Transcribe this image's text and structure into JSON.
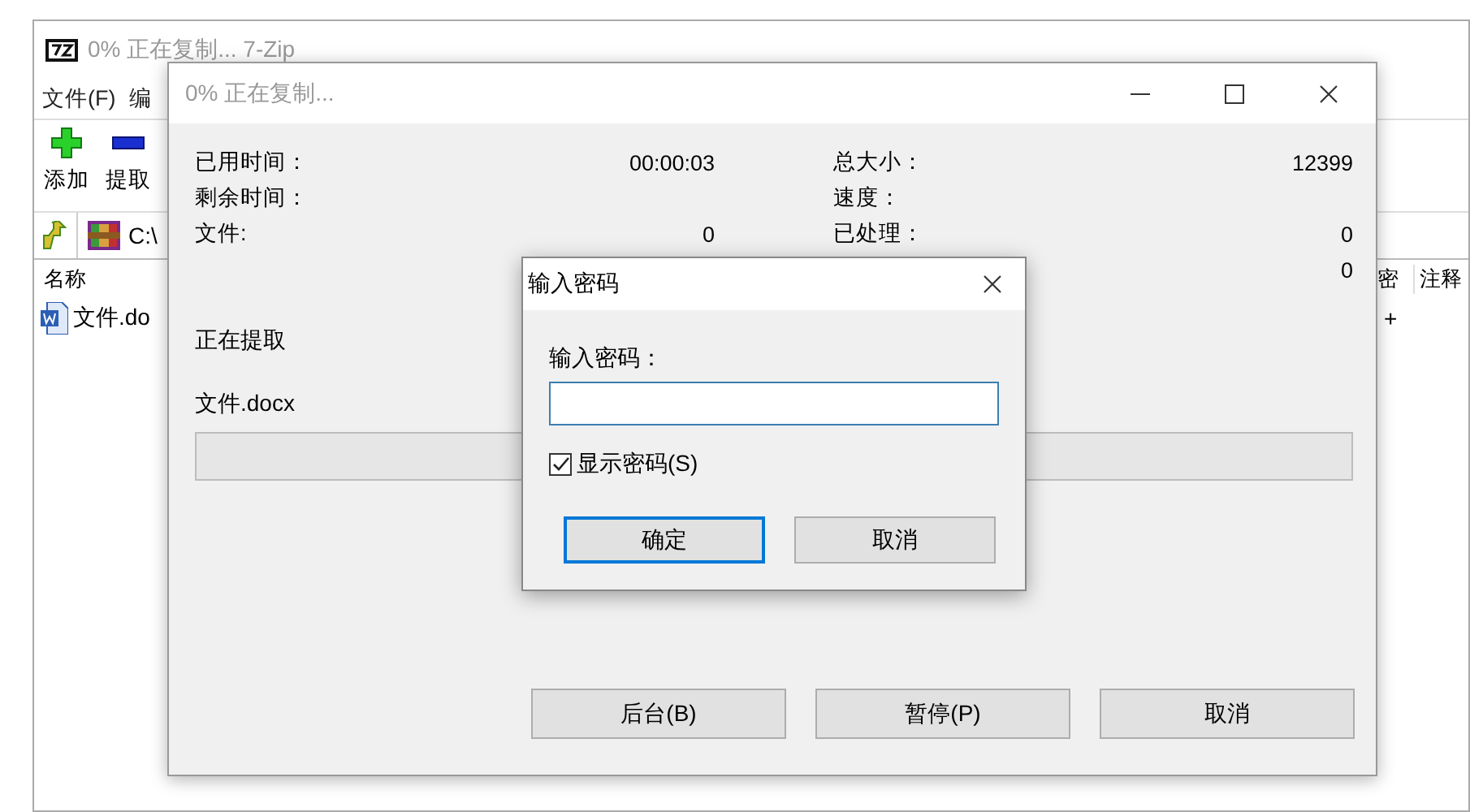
{
  "main_window": {
    "title": "0% 正在复制... 7-Zip",
    "active": false,
    "menu": [
      "文件(F)",
      "编"
    ],
    "toolbar": [
      {
        "kind": "add",
        "label": "添加"
      },
      {
        "kind": "extract",
        "label": "提取"
      }
    ],
    "address": "C:\\",
    "columns": [
      "名称",
      "密",
      "注释"
    ],
    "rows": [
      {
        "name": "文件.do",
        "column_2": "+"
      }
    ]
  },
  "progress_dialog": {
    "title": "0% 正在复制...",
    "active": false,
    "left_stats": [
      {
        "label": "已用时间：",
        "value": "00:00:03"
      },
      {
        "label": "剩余时间："
      },
      {
        "label": "文件:",
        "value": "0"
      }
    ],
    "right_stats": [
      {
        "label": "总大小：",
        "value": "12399"
      },
      {
        "label": "速度："
      },
      {
        "label": "已处理：",
        "value": "0"
      },
      {
        "value": "0"
      }
    ],
    "operation": "正在提取",
    "current_file": "文件.docx",
    "progress": {
      "level": 0
    },
    "buttons": [
      "后台(B)",
      "暂停(P)",
      "取消"
    ]
  },
  "password_dialog": {
    "title": "输入密码",
    "active": true,
    "field_label": "输入密码：",
    "show_password": {
      "label": "显示密码(S)",
      "checked": true
    },
    "buttons": [
      {
        "label": "确定",
        "default": true
      },
      {
        "label": "取消",
        "default": false
      }
    ]
  }
}
